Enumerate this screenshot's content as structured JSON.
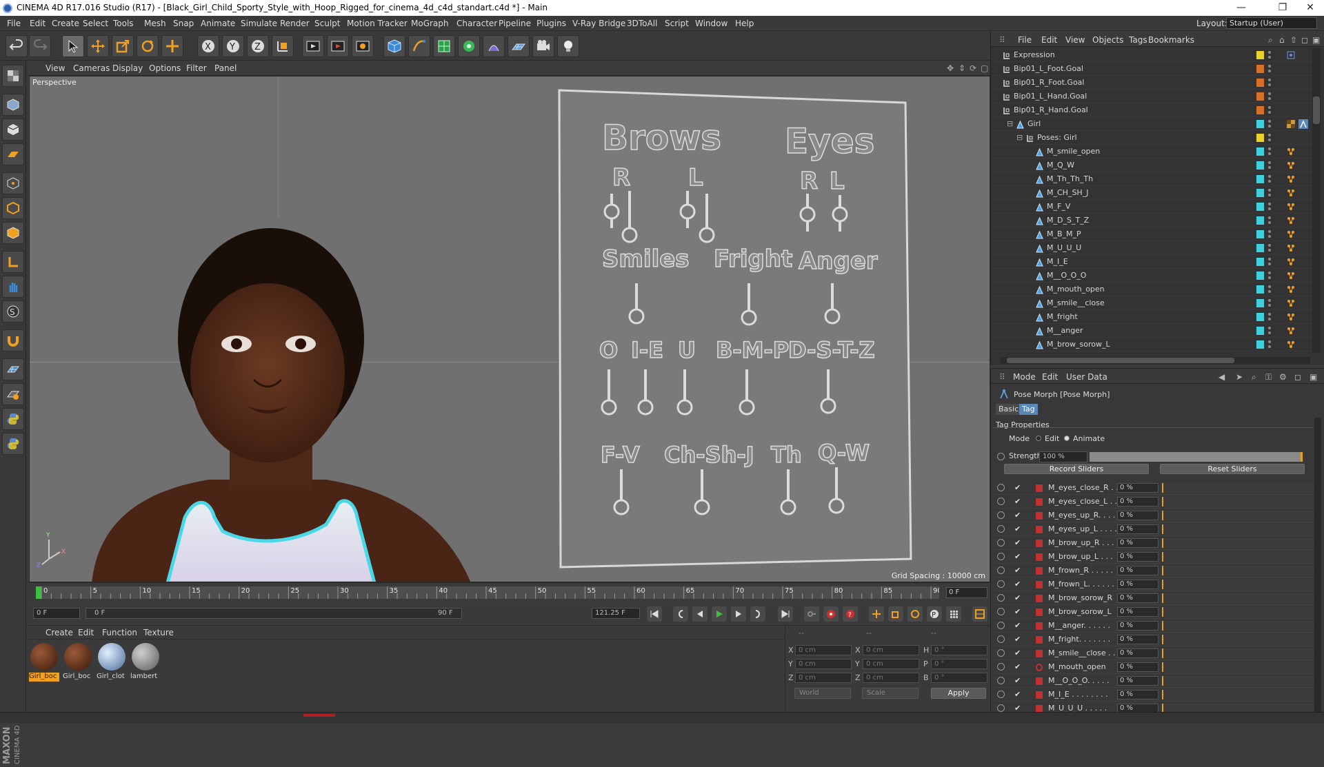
{
  "titlebar": {
    "text": "CINEMA 4D R17.016 Studio (R17) - [Black_Girl_Child_Sporty_Style_with_Hoop_Rigged_for_cinema_4d_c4d_standart.c4d *] - Main",
    "minimize": "—",
    "restore": "❐",
    "close": "✕"
  },
  "menubar": {
    "items": [
      "File",
      "Edit",
      "Create",
      "Select",
      "Tools",
      "Mesh",
      "Snap",
      "Animate",
      "Simulate",
      "Render",
      "Sculpt",
      "Motion Tracker",
      "MoGraph",
      "Character",
      "Pipeline",
      "Plugins",
      "V-Ray Bridge",
      "3DToAll",
      "Script",
      "Window",
      "Help"
    ],
    "layout_label": "Layout:",
    "layout_value": "Startup (User)"
  },
  "viewport": {
    "menu": [
      "View",
      "Cameras",
      "Display",
      "Options",
      "Filter",
      "Panel"
    ],
    "label": "Perspective",
    "grid_spacing": "Grid Spacing : 10000 cm",
    "board": {
      "brows": "Brows",
      "eyes": "Eyes",
      "r1": "R",
      "l1": "L",
      "r2": "R",
      "l2": "L",
      "smiles": "Smiles",
      "fright": "Fright",
      "anger": "Anger",
      "o": "O",
      "ie": "I-E",
      "u": "U",
      "bmp": "B-M-P",
      "dstz": "D-S-T-Z",
      "fv": "F-V",
      "chshj": "Ch-Sh-J",
      "th": "Th",
      "qw": "Q-W"
    }
  },
  "timeline": {
    "ticks": [
      "0",
      "5",
      "10",
      "15",
      "20",
      "25",
      "30",
      "35",
      "40",
      "45",
      "50",
      "55",
      "60",
      "65",
      "70",
      "75",
      "80",
      "85",
      "90"
    ],
    "frame_field": "0 F",
    "current": 0,
    "end": 90
  },
  "transport": {
    "start_field": "0 F",
    "range_start": "0 F",
    "range_end": "90 F",
    "fps_field": "121.25 F"
  },
  "materials": {
    "menu": [
      "Create",
      "Edit",
      "Function",
      "Texture"
    ],
    "items": [
      {
        "name": "Girl_boc",
        "color": "#5a2a1a",
        "selected": true
      },
      {
        "name": "Girl_boc",
        "color": "#5a2a1a",
        "selected": false
      },
      {
        "name": "Girl_clot",
        "color": "#a8c8e8",
        "selected": false
      },
      {
        "name": "lambert",
        "color": "#9a9a9a",
        "selected": false
      }
    ]
  },
  "coords": {
    "header": [
      "--",
      "--",
      "--"
    ],
    "x_label": "X",
    "y_label": "Y",
    "z_label": "Z",
    "x2_label": "X",
    "y2_label": "Y",
    "z2_label": "Z",
    "h_label": "H",
    "p_label": "P",
    "b_label": "B",
    "pos_x": "0 cm",
    "pos_y": "0 cm",
    "pos_z": "0 cm",
    "size_x": "0 cm",
    "size_y": "0 cm",
    "size_z": "0 cm",
    "rot_h": "0 °",
    "rot_p": "0 °",
    "rot_b": "0 °",
    "mode1": "World",
    "mode2": "Scale",
    "apply": "Apply"
  },
  "objects": {
    "menu": [
      "File",
      "Edit",
      "View",
      "Objects",
      "Tags",
      "Bookmarks"
    ],
    "rows": [
      {
        "name": "Expression",
        "indent": 0,
        "color": "#e6d22a",
        "type": "null"
      },
      {
        "name": "Bip01_L_Foot.Goal",
        "indent": 0,
        "color": "#d8702a",
        "type": "null"
      },
      {
        "name": "Bip01_R_Foot.Goal",
        "indent": 0,
        "color": "#d8702a",
        "type": "null"
      },
      {
        "name": "Bip01_L_Hand.Goal",
        "indent": 0,
        "color": "#d8702a",
        "type": "null"
      },
      {
        "name": "Bip01_R_Hand.Goal",
        "indent": 0,
        "color": "#d8702a",
        "type": "null"
      },
      {
        "name": "Girl",
        "indent": 1,
        "color": "#40d0e0",
        "type": "poly"
      },
      {
        "name": "Poses: Girl",
        "indent": 2,
        "color": "#e6d22a",
        "type": "null"
      },
      {
        "name": "M_smile_open",
        "indent": 3,
        "color": "#40d0e0",
        "type": "poly"
      },
      {
        "name": "M_Q_W",
        "indent": 3,
        "color": "#40d0e0",
        "type": "poly"
      },
      {
        "name": "M_Th_Th_Th",
        "indent": 3,
        "color": "#40d0e0",
        "type": "poly"
      },
      {
        "name": "M_CH_SH_J",
        "indent": 3,
        "color": "#40d0e0",
        "type": "poly"
      },
      {
        "name": "M_F_V",
        "indent": 3,
        "color": "#40d0e0",
        "type": "poly"
      },
      {
        "name": "M_D_S_T_Z",
        "indent": 3,
        "color": "#40d0e0",
        "type": "poly"
      },
      {
        "name": "M_B_M_P",
        "indent": 3,
        "color": "#40d0e0",
        "type": "poly"
      },
      {
        "name": "M_U_U_U",
        "indent": 3,
        "color": "#40d0e0",
        "type": "poly"
      },
      {
        "name": "M_I_E",
        "indent": 3,
        "color": "#40d0e0",
        "type": "poly"
      },
      {
        "name": "M__O_O_O",
        "indent": 3,
        "color": "#40d0e0",
        "type": "poly"
      },
      {
        "name": "M_mouth_open",
        "indent": 3,
        "color": "#40d0e0",
        "type": "poly"
      },
      {
        "name": "M_smile__close",
        "indent": 3,
        "color": "#40d0e0",
        "type": "poly"
      },
      {
        "name": "M_fright",
        "indent": 3,
        "color": "#40d0e0",
        "type": "poly"
      },
      {
        "name": "M__anger",
        "indent": 3,
        "color": "#40d0e0",
        "type": "poly"
      },
      {
        "name": "M_brow_sorow_L",
        "indent": 3,
        "color": "#40d0e0",
        "type": "poly"
      }
    ]
  },
  "attributes": {
    "menu": [
      "Mode",
      "Edit",
      "User Data"
    ],
    "title": "Pose Morph [Pose Morph]",
    "tabs": [
      "Basic",
      "Tag"
    ],
    "active_tab": "Tag",
    "section": "Tag Properties",
    "mode_label": "Mode",
    "mode_edit": "Edit",
    "mode_animate": "Animate",
    "strength_label": "Strength",
    "strength_value": "100 %",
    "strength": 1.0,
    "record": "Record Sliders",
    "reset": "Reset Sliders",
    "morphs": [
      {
        "name": "M_eyes_close_R . .",
        "value": "0 %"
      },
      {
        "name": "M_eyes_close_L . .",
        "value": "0 %"
      },
      {
        "name": "M_eyes_up_R. . . .",
        "value": "0 %"
      },
      {
        "name": "M_eyes_up_L . . . .",
        "value": "0 %"
      },
      {
        "name": "M_brow_up_R . . .",
        "value": "0 %"
      },
      {
        "name": "M_brow_up_L . . .",
        "value": "0 %"
      },
      {
        "name": "M_frown_R . . . . .",
        "value": "0 %"
      },
      {
        "name": "M_frown_L. . . . . .",
        "value": "0 %"
      },
      {
        "name": "M_brow_sorow_R",
        "value": "0 %"
      },
      {
        "name": "M_brow_sorow_L",
        "value": "0 %"
      },
      {
        "name": "M__anger. . . . . .",
        "value": "0 %"
      },
      {
        "name": "M_fright. . . . . . .",
        "value": "0 %"
      },
      {
        "name": "M_smile__close . .",
        "value": "0 %"
      },
      {
        "name": "M_mouth_open",
        "value": "0 %"
      },
      {
        "name": "M__O_O_O. . . . .",
        "value": "0 %"
      },
      {
        "name": "M_I_E . . . . . . . .",
        "value": "0 %"
      },
      {
        "name": "M_U_U_U . . . . .",
        "value": "0 %"
      }
    ]
  },
  "branding": {
    "maxon": "MAXON",
    "c4d": "CINEMA 4D"
  },
  "icons": [
    "undo-icon",
    "redo-icon",
    "select-arrow-icon",
    "move-icon",
    "scale-icon",
    "rotate-icon",
    "axis-x-icon",
    "axis-y-icon",
    "axis-z-icon",
    "render-icon",
    "cube-icon",
    "light-icon",
    "camera-icon"
  ]
}
